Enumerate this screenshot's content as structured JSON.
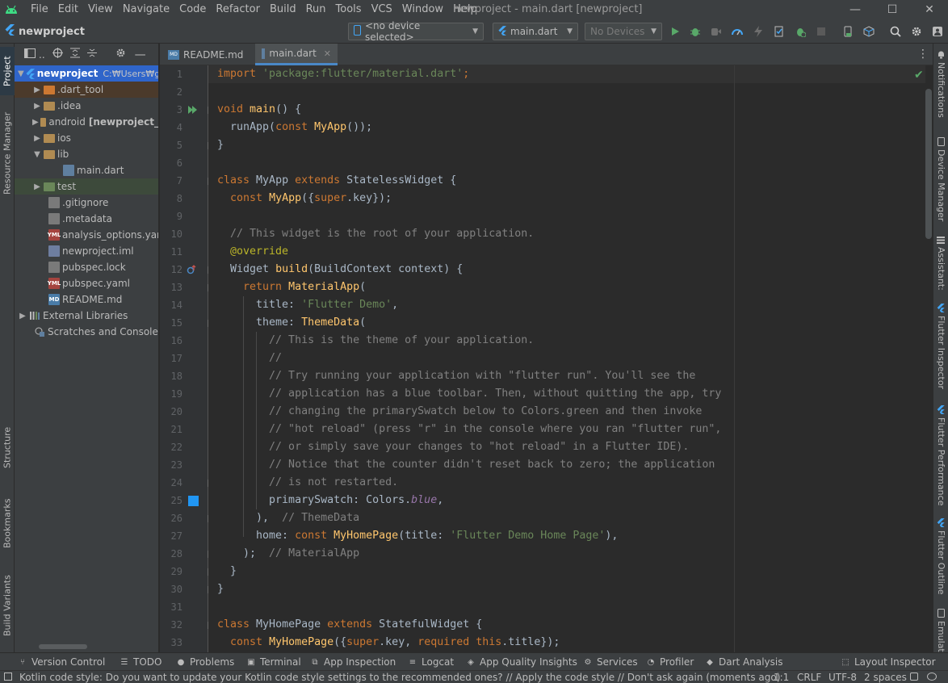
{
  "window": {
    "title": "newproject - main.dart [newproject]",
    "minimize": "—",
    "maximize": "☐",
    "close": "✕"
  },
  "menu": [
    "File",
    "Edit",
    "View",
    "Navigate",
    "Code",
    "Refactor",
    "Build",
    "Run",
    "Tools",
    "VCS",
    "Window",
    "Help"
  ],
  "navbar": {
    "project": "newproject",
    "device_selector": "<no device selected>",
    "run_config": "main.dart",
    "devices_combo": "No Devices"
  },
  "left_stripe": {
    "project": "Project",
    "resource_manager": "Resource Manager",
    "structure": "Structure",
    "bookmarks": "Bookmarks",
    "build_variants": "Build Variants"
  },
  "right_stripe": {
    "notifications": "Notifications",
    "device_manager": "Device Manager",
    "assistant": "Assistant:",
    "flutter_inspector": "Flutter Inspector",
    "flutter_performance": "Flutter Performance",
    "flutter_outline": "Flutter Outline",
    "emulator": "Emulat"
  },
  "project_panel": {
    "header_label": "..",
    "tree": [
      {
        "label": "newproject",
        "path": "C:₩Users₩gr",
        "icon": "flutter-project-icon"
      },
      {
        "label": ".dart_tool",
        "icon": "folder-icon"
      },
      {
        "label": ".idea",
        "icon": "folder-icon"
      },
      {
        "label": "android",
        "extra": "[newproject_",
        "icon": "folder-icon"
      },
      {
        "label": "ios",
        "icon": "folder-icon"
      },
      {
        "label": "lib",
        "icon": "folder-icon"
      },
      {
        "label": "main.dart",
        "icon": "dart-file-icon"
      },
      {
        "label": "test",
        "icon": "folder-icon"
      },
      {
        "label": ".gitignore",
        "icon": "file-icon"
      },
      {
        "label": ".metadata",
        "icon": "file-icon"
      },
      {
        "label": "analysis_options.yaml",
        "icon": "yaml-icon",
        "badge": "YML"
      },
      {
        "label": "newproject.iml",
        "icon": "iml-icon"
      },
      {
        "label": "pubspec.lock",
        "icon": "file-icon"
      },
      {
        "label": "pubspec.yaml",
        "icon": "yaml-icon",
        "badge": "YML"
      },
      {
        "label": "README.md",
        "icon": "markdown-icon",
        "badge": "MD"
      },
      {
        "label": "External Libraries",
        "icon": "libraries-icon"
      },
      {
        "label": "Scratches and Consoles",
        "icon": "scratches-icon"
      }
    ]
  },
  "editor_tabs": [
    {
      "label": "README.md",
      "badge": "MD"
    },
    {
      "label": "main.dart"
    }
  ],
  "code": {
    "line_numbers": [
      "1",
      "2",
      "3",
      "4",
      "5",
      "6",
      "7",
      "8",
      "9",
      "10",
      "11",
      "12",
      "13",
      "14",
      "15",
      "16",
      "17",
      "18",
      "19",
      "20",
      "21",
      "22",
      "23",
      "24",
      "25",
      "26",
      "27",
      "28",
      "29",
      "30",
      "31",
      "32",
      "33"
    ],
    "lines": [
      [
        [
          "kw",
          "import "
        ],
        [
          "str",
          "'package:flutter/material.dart'"
        ],
        [
          "kw",
          ";"
        ]
      ],
      [],
      [
        [
          "kw",
          "void "
        ],
        [
          "fn",
          "main"
        ],
        [
          "",
          "() {"
        ]
      ],
      [
        [
          "",
          "  runApp("
        ],
        [
          "kw",
          "const "
        ],
        [
          "fn",
          "MyApp"
        ],
        [
          "",
          "());"
        ]
      ],
      [
        [
          "",
          "}"
        ]
      ],
      [],
      [
        [
          "kw",
          "class "
        ],
        [
          "",
          "MyApp "
        ],
        [
          "kw",
          "extends "
        ],
        [
          "",
          "StatelessWidget {"
        ]
      ],
      [
        [
          "",
          "  "
        ],
        [
          "kw",
          "const "
        ],
        [
          "fn",
          "MyApp"
        ],
        [
          "",
          "({"
        ],
        [
          "kw",
          "super"
        ],
        [
          "",
          ".key});"
        ]
      ],
      [],
      [
        [
          "cmt",
          "  // This widget is the root of your application."
        ]
      ],
      [
        [
          "",
          "  "
        ],
        [
          "ann",
          "@override"
        ]
      ],
      [
        [
          "",
          "  Widget "
        ],
        [
          "fn",
          "build"
        ],
        [
          "",
          "(BuildContext context) {"
        ]
      ],
      [
        [
          "",
          "    "
        ],
        [
          "kw",
          "return "
        ],
        [
          "fn",
          "MaterialApp"
        ],
        [
          "",
          "("
        ]
      ],
      [
        [
          "",
          "      title: "
        ],
        [
          "str",
          "'Flutter Demo'"
        ],
        [
          "",
          ","
        ]
      ],
      [
        [
          "",
          "      theme: "
        ],
        [
          "fn",
          "ThemeData"
        ],
        [
          "",
          "("
        ]
      ],
      [
        [
          "cmt",
          "        // This is the theme of your application."
        ]
      ],
      [
        [
          "cmt",
          "        //"
        ]
      ],
      [
        [
          "cmt",
          "        // Try running your application with \"flutter run\". You'll see the"
        ]
      ],
      [
        [
          "cmt",
          "        // application has a blue toolbar. Then, without quitting the app, try"
        ]
      ],
      [
        [
          "cmt",
          "        // changing the primarySwatch below to Colors.green and then invoke"
        ]
      ],
      [
        [
          "cmt",
          "        // \"hot reload\" (press \"r\" in the console where you ran \"flutter run\","
        ]
      ],
      [
        [
          "cmt",
          "        // or simply save your changes to \"hot reload\" in a Flutter IDE)."
        ]
      ],
      [
        [
          "cmt",
          "        // Notice that the counter didn't reset back to zero; the application"
        ]
      ],
      [
        [
          "cmt",
          "        // is not restarted."
        ]
      ],
      [
        [
          "",
          "        primarySwatch: Colors."
        ],
        [
          "it",
          "blue"
        ],
        [
          "",
          ","
        ]
      ],
      [
        [
          "",
          "      ),  "
        ],
        [
          "cmt",
          "// ThemeData"
        ]
      ],
      [
        [
          "",
          "      home: "
        ],
        [
          "kw",
          "const "
        ],
        [
          "fn",
          "MyHomePage"
        ],
        [
          "",
          "(title: "
        ],
        [
          "str",
          "'Flutter Demo Home Page'"
        ],
        [
          "",
          "),"
        ]
      ],
      [
        [
          "",
          "    );  "
        ],
        [
          "cmt",
          "// MaterialApp"
        ]
      ],
      [
        [
          "",
          "  }"
        ]
      ],
      [
        [
          "",
          "}"
        ]
      ],
      [],
      [
        [
          "kw",
          "class "
        ],
        [
          "",
          "MyHomePage "
        ],
        [
          "kw",
          "extends "
        ],
        [
          "",
          "StatefulWidget {"
        ]
      ],
      [
        [
          "",
          "  "
        ],
        [
          "kw",
          "const "
        ],
        [
          "fn",
          "MyHomePage"
        ],
        [
          "",
          "({"
        ],
        [
          "kw",
          "super"
        ],
        [
          "",
          ".key, "
        ],
        [
          "kw",
          "required this"
        ],
        [
          "",
          ".title});"
        ]
      ]
    ]
  },
  "bottom_tools": [
    {
      "label": "Version Control",
      "icon": "version-control-icon"
    },
    {
      "label": "TODO",
      "icon": "todo-icon"
    },
    {
      "label": "Problems",
      "icon": "problems-icon"
    },
    {
      "label": "Terminal",
      "icon": "terminal-icon"
    },
    {
      "label": "App Inspection",
      "icon": "app-inspection-icon"
    },
    {
      "label": "Logcat",
      "icon": "logcat-icon"
    },
    {
      "label": "App Quality Insights",
      "icon": "app-quality-icon"
    },
    {
      "label": "Services",
      "icon": "services-icon"
    },
    {
      "label": "Profiler",
      "icon": "profiler-icon"
    },
    {
      "label": "Dart Analysis",
      "icon": "dart-analysis-icon"
    },
    {
      "label": "Layout Inspector",
      "icon": "layout-inspector-icon"
    }
  ],
  "status": {
    "message": "Kotlin code style: Do you want to update your Kotlin code style settings to the recommended ones? // Apply the code style // Don't ask again (moments ago)",
    "position": "1:1",
    "line_sep": "CRLF",
    "encoding": "UTF-8",
    "indent": "2 spaces"
  },
  "colors": {
    "accent": "#2f65ca",
    "flutter_blue": "#42a5f5",
    "run_green": "#59a869",
    "swatch_blue": "#2196f3"
  }
}
